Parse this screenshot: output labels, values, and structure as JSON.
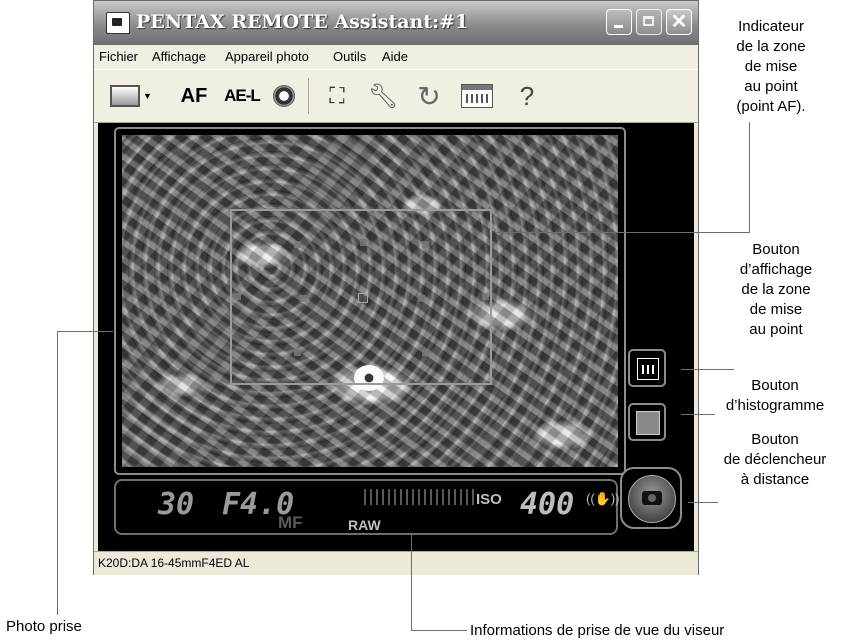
{
  "window": {
    "title": "PENTAX REMOTE Assistant:#1",
    "controls": {
      "minimize": "_",
      "maximize": "□",
      "close": "✕"
    }
  },
  "menubar": [
    "Fichier",
    "Affichage",
    "Appareil photo",
    "Outils",
    "Aide"
  ],
  "toolbar": {
    "af_label": "AF",
    "ael_label": "AE-L",
    "icons": [
      "frame-select-icon",
      "af-icon",
      "ae-lock-icon",
      "aperture-ring-icon",
      "camera-link-icon",
      "wrench-icon",
      "refresh-icon",
      "calendar-icon",
      "help-icon"
    ]
  },
  "viewfinder_info": {
    "shutter": "30",
    "aperture": "F4.0",
    "mf": "MF",
    "raw": "RAW",
    "iso_label": "ISO",
    "iso_value": "400"
  },
  "status": {
    "text": "K20D:DA 16-45mmF4ED AL"
  },
  "callouts": {
    "af_point_indicator": [
      "Indicateur",
      "de la zone",
      "de mise",
      "au point",
      "(point AF)."
    ],
    "af_display_button": [
      "Bouton",
      "d’affichage",
      "de la zone",
      "de mise",
      "au point"
    ],
    "histogram_button": [
      "Bouton",
      "d’histogramme"
    ],
    "remote_shutter_button": [
      "Bouton",
      "de déclencheur",
      "à distance"
    ],
    "captured_photo": "Photo prise",
    "viewfinder_info": "Informations de prise de vue du viseur"
  }
}
